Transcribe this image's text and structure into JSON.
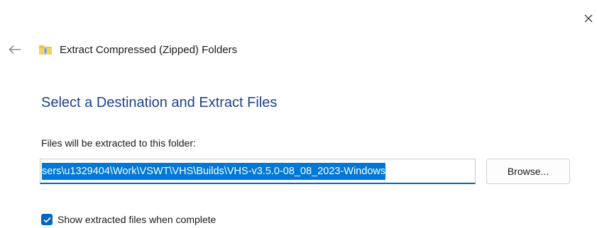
{
  "window": {
    "close_icon": "close-icon"
  },
  "header": {
    "back_icon": "back-arrow-icon",
    "app_icon": "zip-folder-icon",
    "title": "Extract Compressed (Zipped) Folders"
  },
  "main": {
    "heading": "Select a Destination and Extract Files",
    "folder_label": "Files will be extracted to this folder:",
    "path_value": "sers\\u1329404\\Work\\VSWT\\VHS\\Builds\\VHS-v3.5.0-08_08_2023-Windows",
    "browse_label": "Browse...",
    "show_files_label": "Show extracted files when complete",
    "show_files_checked": true
  },
  "colors": {
    "accent": "#0067c0",
    "heading": "#1f3f8f",
    "selection": "#0078d7"
  }
}
